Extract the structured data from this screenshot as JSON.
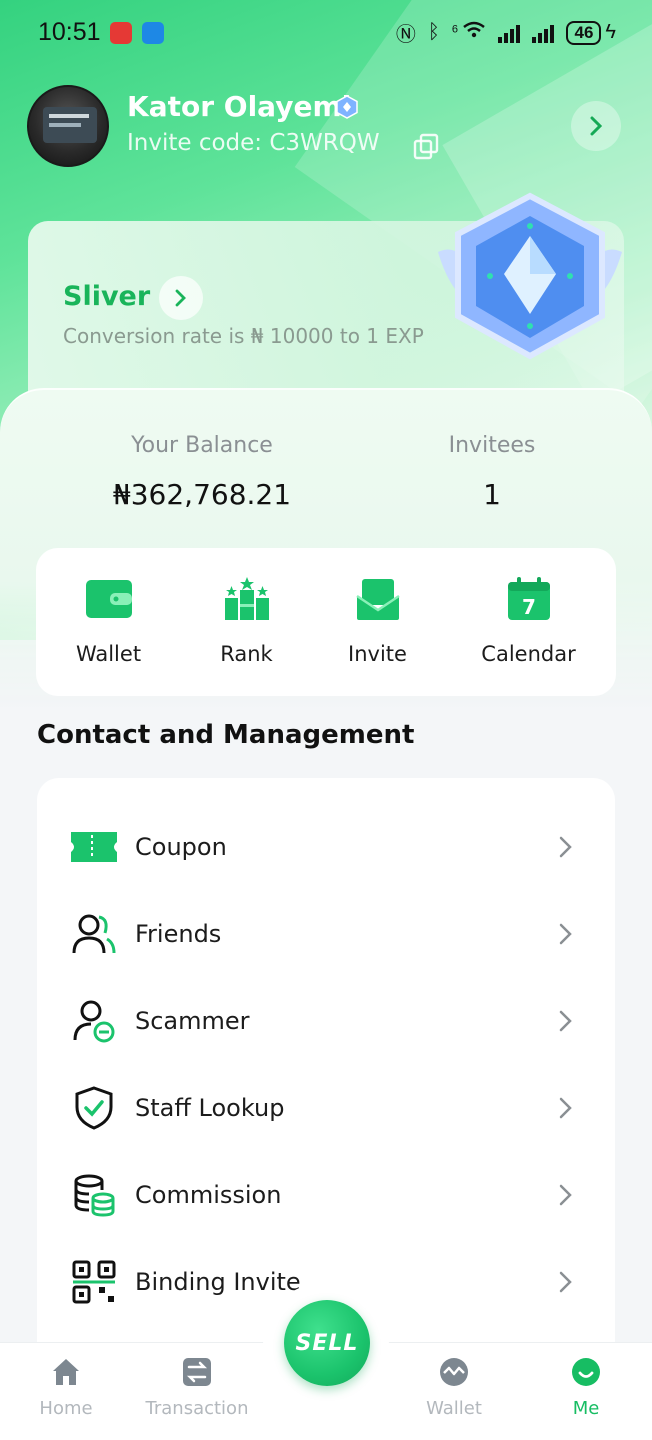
{
  "status_bar": {
    "time": "10:51",
    "network_label": "6",
    "battery": "46"
  },
  "profile": {
    "name": "Kator Olayemi",
    "invite_code": "Invite code: C3WRQW"
  },
  "level": {
    "title": "Sliver",
    "description": "Conversion rate is ₦ 10000 to 1 EXP"
  },
  "stats": {
    "balance_label": "Your Balance",
    "balance_value": "₦362,768.21",
    "invitees_label": "Invitees",
    "invitees_value": "1"
  },
  "quick_actions": [
    {
      "label": "Wallet",
      "icon": "wallet-icon"
    },
    {
      "label": "Rank",
      "icon": "rank-icon"
    },
    {
      "label": "Invite",
      "icon": "invite-icon"
    },
    {
      "label": "Calendar",
      "icon": "calendar-icon",
      "badge": "7"
    }
  ],
  "section_title": "Contact and Management",
  "menu": [
    {
      "label": "Coupon",
      "icon": "coupon-icon"
    },
    {
      "label": "Friends",
      "icon": "friends-icon"
    },
    {
      "label": "Scammer",
      "icon": "scammer-icon"
    },
    {
      "label": "Staff Lookup",
      "icon": "shield-check-icon"
    },
    {
      "label": "Commission",
      "icon": "commission-icon"
    },
    {
      "label": "Binding Invite",
      "icon": "qr-code-icon"
    }
  ],
  "sell_button": "SELL",
  "bottom_nav": [
    {
      "label": "Home",
      "icon": "home-icon",
      "active": false
    },
    {
      "label": "Transaction",
      "icon": "transaction-icon",
      "active": false
    },
    {
      "label": "Wallet",
      "icon": "wallet-nav-icon",
      "active": false
    },
    {
      "label": "Me",
      "icon": "me-icon",
      "active": true
    }
  ],
  "colors": {
    "brand_green": "#19b45a",
    "accent_green": "#1bc36c",
    "inactive_gray": "#b3b8bd"
  }
}
